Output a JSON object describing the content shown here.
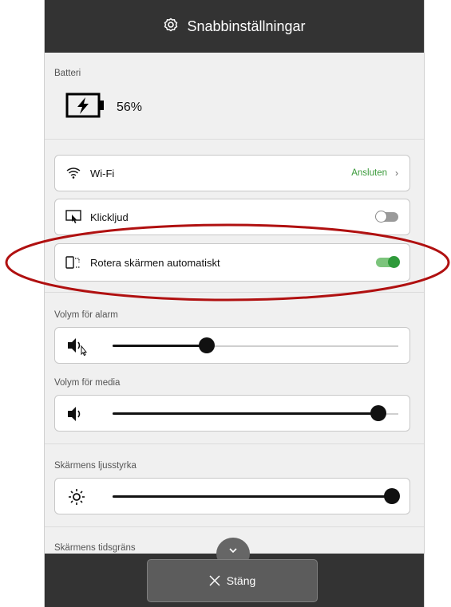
{
  "header": {
    "title": "Snabbinställningar",
    "icon": "gear-icon"
  },
  "battery": {
    "label": "Batteri",
    "percent": "56%",
    "icon": "battery-charging-icon"
  },
  "settings": [
    {
      "label": "Wi-Fi",
      "icon": "wifi-icon",
      "status": "Ansluten"
    },
    {
      "label": "Klickljud",
      "icon": "touch-sound-icon",
      "toggle": false
    },
    {
      "label": "Rotera skärmen automatiskt",
      "icon": "auto-rotate-icon",
      "toggle": true
    }
  ],
  "sliders": [
    {
      "label": "Volym för alarm",
      "icon": "alarm-volume-icon",
      "level": 0.33
    },
    {
      "label": "Volym för media",
      "icon": "volume-icon",
      "level": 0.93
    },
    {
      "label": "Skärmens ljusstyrka",
      "icon": "brightness-icon",
      "level": 1.0
    }
  ],
  "timeout": {
    "label": "Skärmens tidsgräns"
  },
  "footer": {
    "close_label": "Stäng",
    "close_icon": "close-icon"
  },
  "colors": {
    "topbar": "#333333",
    "accent_green": "#2e9a3a",
    "annotation": "#b01010"
  }
}
